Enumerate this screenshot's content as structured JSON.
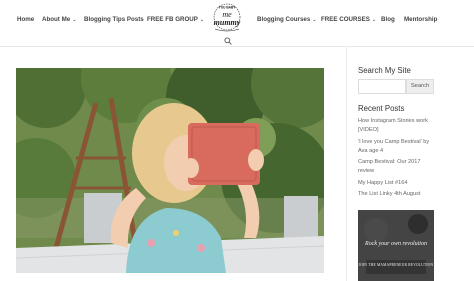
{
  "nav": {
    "left": [
      {
        "label": "Home",
        "dropdown": false
      },
      {
        "label": "About Me",
        "dropdown": true
      },
      {
        "label": "Blogging Tips Posts",
        "dropdown": false
      },
      {
        "label": "FREE FB GROUP",
        "dropdown": true
      }
    ],
    "right": [
      {
        "label": "Blogging Courses",
        "dropdown": true
      },
      {
        "label": "FREE COURSES",
        "dropdown": true
      },
      {
        "label": "Blog",
        "dropdown": false
      },
      {
        "label": "Mentorship",
        "dropdown": false
      }
    ],
    "caret": "⌄",
    "logo": {
      "top": "YOU BABY",
      "main1": "me",
      "main2": "mummy"
    }
  },
  "sidebar": {
    "search_title": "Search My Site",
    "search_button": "Search",
    "search_placeholder": "",
    "recent_title": "Recent Posts",
    "recent_posts": [
      "How Instagram Stories work [VIDEO]",
      "'I love you Camp Bestival' by Ava age 4",
      "Camp Bestival: Our 2017 review",
      "My Happy List #164",
      "The List Linky 4th August"
    ],
    "ad": {
      "line1": "Rock your own revolution",
      "line2": "JOIN THE MAMAPRENEUR REVOLUTION"
    }
  },
  "colors": {
    "nav_text": "#444444",
    "link": "#666666",
    "button_bg": "#eeeeee",
    "tablet": "#d96a5e"
  }
}
